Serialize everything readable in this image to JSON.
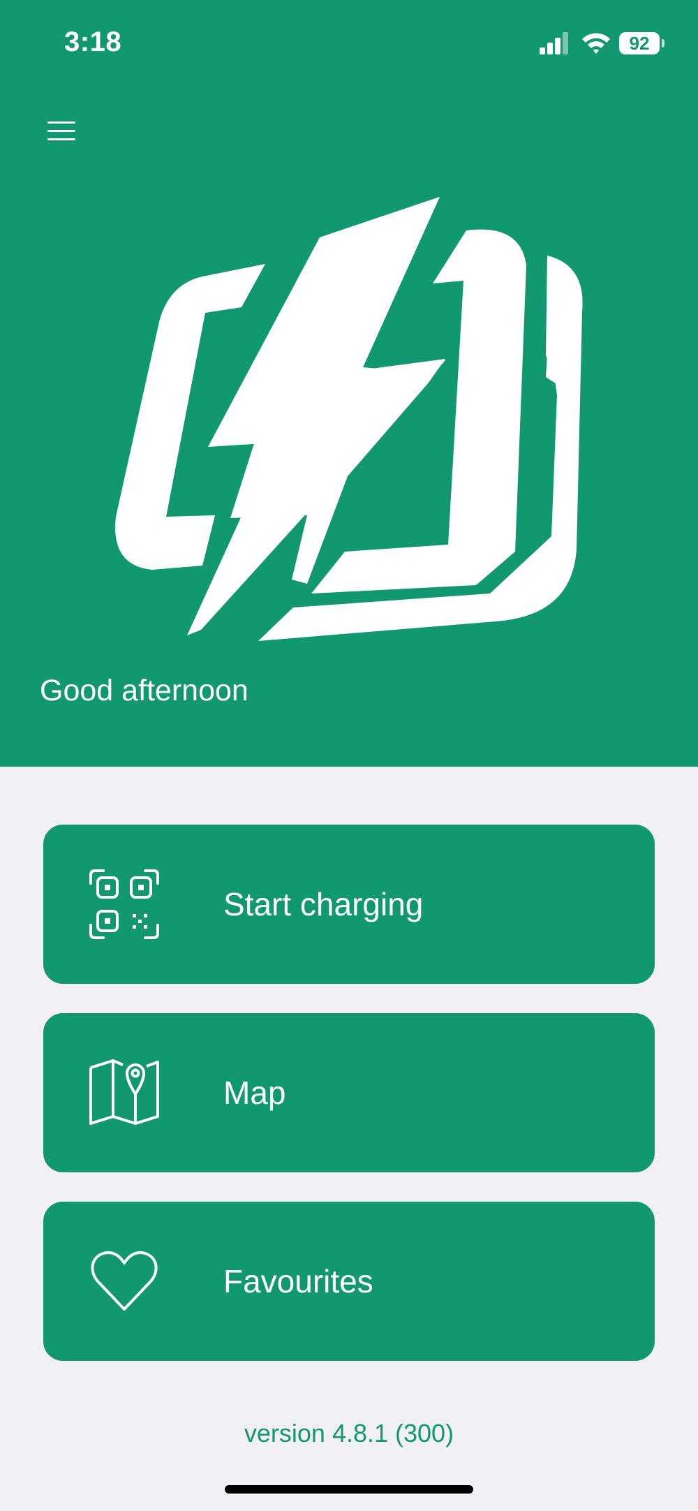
{
  "status_bar": {
    "time": "3:18",
    "battery": "92",
    "signal_icon": "cellular-signal-icon",
    "wifi_icon": "wifi-icon"
  },
  "header": {
    "menu_icon": "hamburger-menu-icon",
    "logo_icon": "charging-bolt-logo",
    "greeting": "Good afternoon"
  },
  "actions": [
    {
      "label": "Start charging",
      "icon": "qr-scan-icon"
    },
    {
      "label": "Map",
      "icon": "map-pin-icon"
    },
    {
      "label": "Favourites",
      "icon": "heart-icon"
    }
  ],
  "footer": {
    "version": "version 4.8.1 (300)"
  },
  "colors": {
    "brand": "#129870",
    "background": "#f0f0f5",
    "text_on_brand": "#ffffff"
  }
}
